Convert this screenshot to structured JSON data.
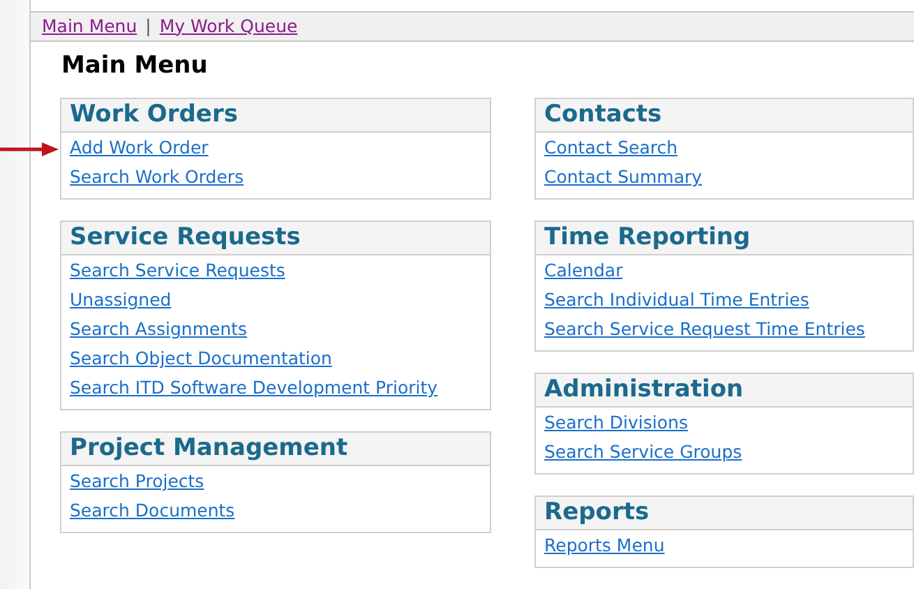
{
  "nav": {
    "links": [
      {
        "label": "Main Menu"
      },
      {
        "label": "My Work Queue"
      }
    ],
    "separator": "|"
  },
  "title": "Main Menu",
  "columns": [
    [
      {
        "heading": "Work Orders",
        "links": [
          {
            "label": "Add Work Order",
            "pointed": true
          },
          {
            "label": "Search Work Orders",
            "pointed": false
          }
        ]
      },
      {
        "heading": "Service Requests",
        "links": [
          {
            "label": "Search Service Requests",
            "pointed": false
          },
          {
            "label": "Unassigned",
            "pointed": false
          },
          {
            "label": "Search Assignments",
            "pointed": false
          },
          {
            "label": "Search Object Documentation",
            "pointed": false
          },
          {
            "label": "Search ITD Software Development Priority",
            "pointed": false
          }
        ]
      },
      {
        "heading": "Project Management",
        "links": [
          {
            "label": "Search Projects",
            "pointed": false
          },
          {
            "label": "Search Documents",
            "pointed": false
          }
        ]
      }
    ],
    [
      {
        "heading": "Contacts",
        "links": [
          {
            "label": "Contact Search",
            "pointed": false
          },
          {
            "label": "Contact Summary",
            "pointed": false
          }
        ]
      },
      {
        "heading": "Time Reporting",
        "links": [
          {
            "label": "Calendar",
            "pointed": false
          },
          {
            "label": "Search Individual Time Entries",
            "pointed": false
          },
          {
            "label": "Search Service Request Time Entries",
            "pointed": false
          }
        ]
      },
      {
        "heading": "Administration",
        "links": [
          {
            "label": "Search Divisions",
            "pointed": false
          },
          {
            "label": "Search Service Groups",
            "pointed": false
          }
        ]
      },
      {
        "heading": "Reports",
        "links": [
          {
            "label": "Reports Menu",
            "pointed": false
          }
        ]
      }
    ]
  ]
}
